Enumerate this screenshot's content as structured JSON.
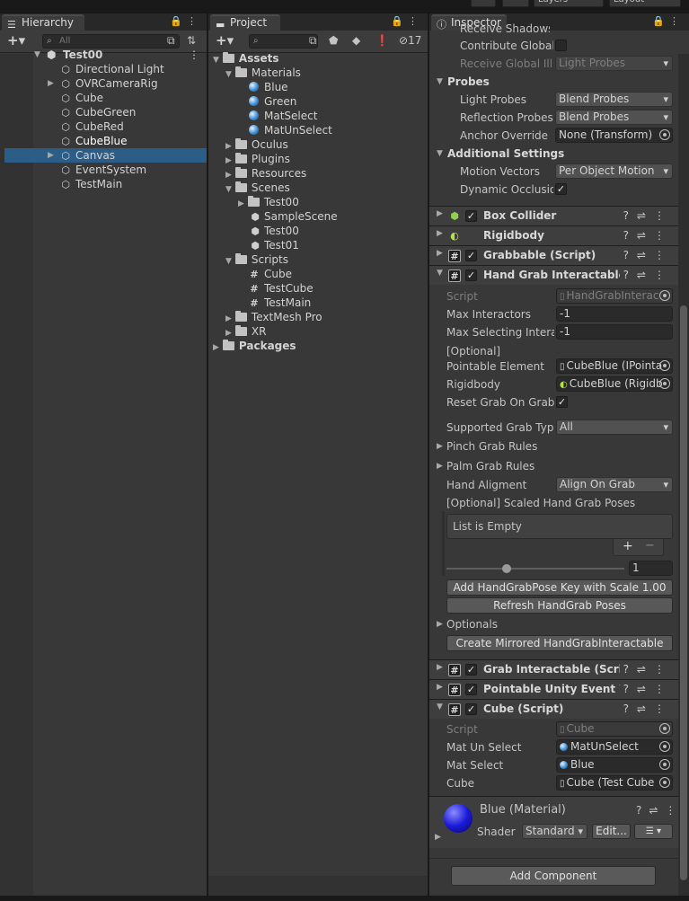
{
  "top": {
    "layers": "Layers",
    "layout": "Layout"
  },
  "hierarchy": {
    "tab": "Hierarchy",
    "search_placeholder": "All",
    "scene": "Test00",
    "items": [
      "Directional Light",
      "OVRCameraRig",
      "Cube",
      "CubeGreen",
      "CubeRed",
      "CubeBlue",
      "Canvas",
      "EventSystem",
      "TestMain"
    ]
  },
  "project": {
    "tab": "Project",
    "badge": "17",
    "assets": "Assets",
    "materials": "Materials",
    "mats": [
      "Blue",
      "Green",
      "MatSelect",
      "MatUnSelect"
    ],
    "folders1": [
      "Oculus",
      "Plugins",
      "Resources"
    ],
    "scenes": "Scenes",
    "scene_items": [
      "Test00",
      "SampleScene",
      "Test00",
      "Test01"
    ],
    "scripts": "Scripts",
    "script_items": [
      "Cube",
      "TestCube",
      "TestMain"
    ],
    "folders2": [
      "TextMesh Pro",
      "XR"
    ],
    "packages": "Packages"
  },
  "inspector": {
    "tab": "Inspector",
    "lighting": {
      "receive_shadows": "Receive Shadows",
      "contribute_gi": "Contribute Global I",
      "receive_gi": "Receive Global Illu",
      "receive_gi_value": "Light Probes"
    },
    "probes": {
      "title": "Probes",
      "light_probes": "Light Probes",
      "light_probes_value": "Blend Probes",
      "reflection_probes": "Reflection Probes",
      "reflection_probes_value": "Blend Probes",
      "anchor_override": "Anchor Override",
      "anchor_override_value": "None (Transform)"
    },
    "additional": {
      "title": "Additional Settings",
      "motion_vectors": "Motion Vectors",
      "motion_vectors_value": "Per Object Motion",
      "dynamic_occlusion": "Dynamic Occlusio"
    },
    "components": {
      "box_collider": "Box Collider",
      "rigidbody": "Rigidbody",
      "grabbable": "Grabbable (Script)",
      "hand_grab": "Hand Grab Interactable (S"
    },
    "hand_grab": {
      "script": "Script",
      "script_value": "HandGrabInterac",
      "max_interactors": "Max Interactors",
      "max_interactors_value": "-1",
      "max_selecting": "Max Selecting Interac",
      "max_selecting_value": "-1",
      "optional": "[Optional]",
      "pointable_element": "Pointable Element",
      "pointable_element_value": "CubeBlue (IPointa",
      "rigidbody": "Rigidbody",
      "rigidbody_value": "CubeBlue (Rigidb",
      "reset_grab": "Reset Grab On Grabs",
      "supported_grab_type": "Supported Grab Type",
      "supported_grab_type_value": "All",
      "pinch_rules": "Pinch Grab Rules",
      "palm_rules": "Palm Grab Rules",
      "hand_alignment": "Hand Aligment",
      "hand_alignment_value": "Align On Grab",
      "scaled_poses": "[Optional] Scaled Hand Grab Poses",
      "list_empty": "List is Empty",
      "plus": "+",
      "minus": "−",
      "slider_value": "1",
      "add_key_button": "Add HandGrabPose Key with Scale 1.00",
      "refresh_button": "Refresh HandGrab Poses",
      "optionals": "Optionals",
      "create_mirrored_button": "Create Mirrored HandGrabInteractable"
    },
    "components2": {
      "grab_interactable": "Grab Interactable (Script)",
      "pointable_unity": "Pointable Unity Event Wra",
      "cube_script": "Cube (Script)"
    },
    "cube": {
      "script": "Script",
      "script_value": "Cube",
      "mat_un_select": "Mat Un Select",
      "mat_un_select_value": "MatUnSelect",
      "mat_select": "Mat Select",
      "mat_select_value": "Blue",
      "cube": "Cube",
      "cube_value": "Cube (Test Cube"
    },
    "material": {
      "name": "Blue (Material)",
      "shader_label": "Shader",
      "shader_value": "Standard",
      "edit_button": "Edit..."
    },
    "add_component": "Add Component"
  }
}
